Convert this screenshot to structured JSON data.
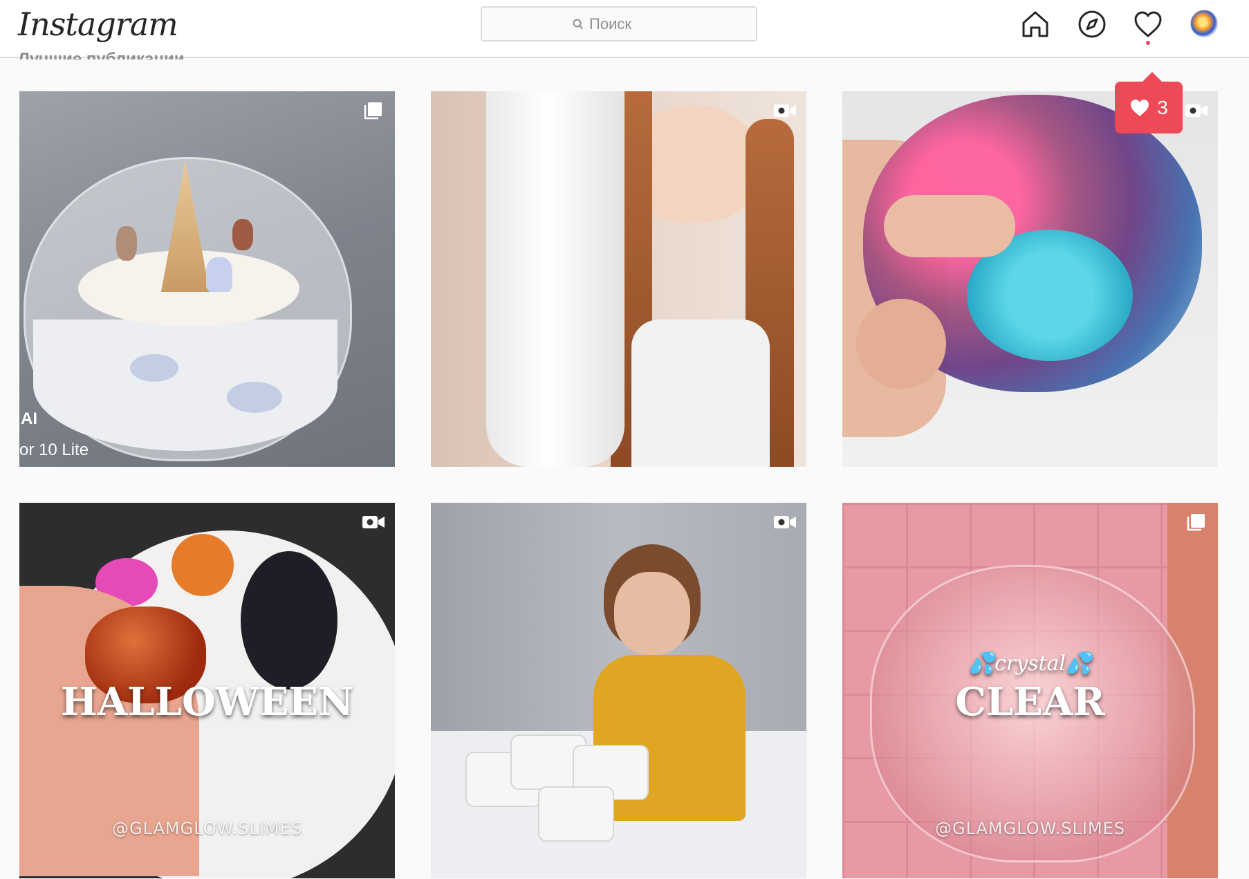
{
  "app": {
    "logo": "Instagram"
  },
  "search": {
    "placeholder": "Поиск",
    "value": ""
  },
  "nav": {
    "icons": [
      "home-icon",
      "explore-compass-icon",
      "activity-heart-icon",
      "profile-avatar"
    ]
  },
  "notifications": {
    "likes_count": "3"
  },
  "section": {
    "title": "Лучшие публикации"
  },
  "posts": [
    {
      "type": "carousel",
      "watermark_line1": "AI",
      "watermark_line2": "or 10 Lite"
    },
    {
      "type": "video"
    },
    {
      "type": "video"
    },
    {
      "type": "video",
      "caption": "HALLOWEEN",
      "handle": "@GLAMGLOW.SLIMES"
    },
    {
      "type": "video"
    },
    {
      "type": "carousel",
      "caption_top": "💦crystal💦",
      "caption": "CLEAR",
      "handle": "@GLAMGLOW.SLIMES"
    }
  ],
  "colors": {
    "accent": "#ed4956",
    "border": "#dbdbdb",
    "text_secondary": "#8e8e8e"
  }
}
